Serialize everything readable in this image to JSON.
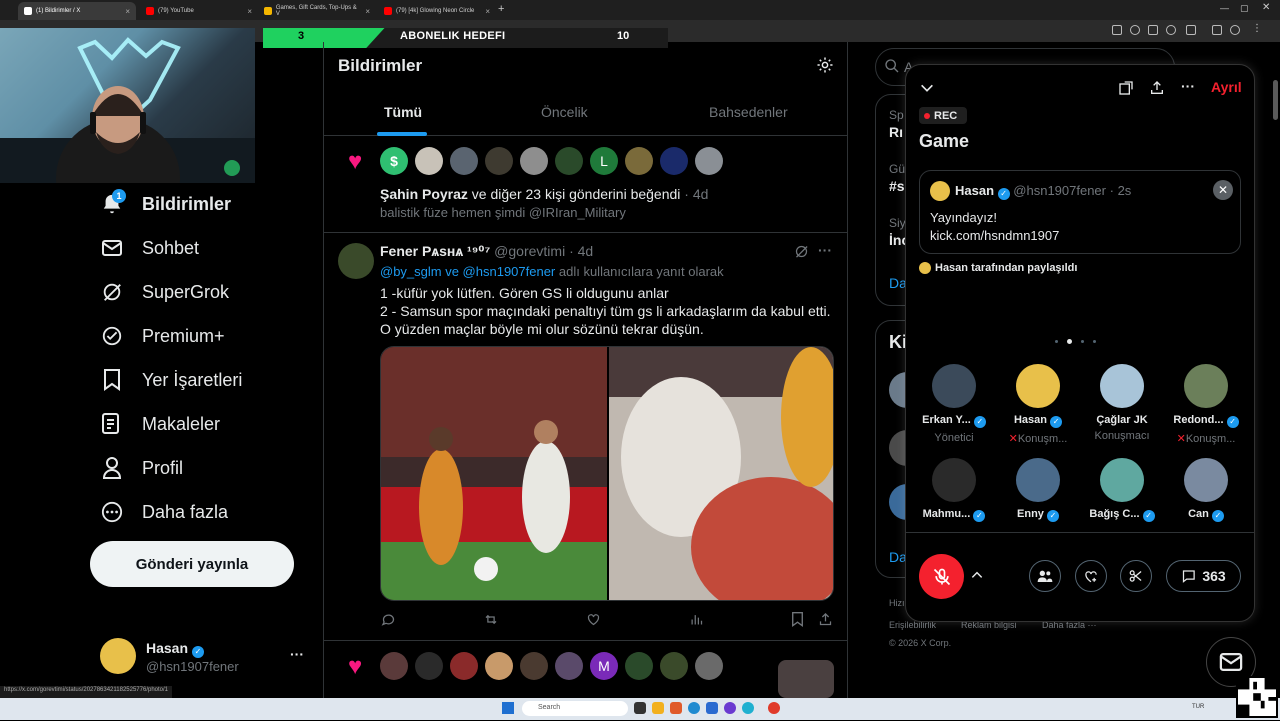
{
  "browser": {
    "tabs": [
      {
        "title": "(1) Bildirimler / X",
        "favicon_color": "#ffffff"
      },
      {
        "title": "(79) YouTube",
        "favicon_color": "#ff0000"
      },
      {
        "title": "Games, Gift Cards, Top-Ups & V",
        "favicon_color": "#f5b700"
      },
      {
        "title": "(79) [4k] Glowing Neon Circle",
        "favicon_color": "#ff0000"
      }
    ],
    "new_tab": "+",
    "status_url": "https://x.com/gorevtimi/status/2027863421182525776/photo/1"
  },
  "overlay": {
    "goal_label": "ABONELIK HEDEFI",
    "current": "3",
    "target": "10",
    "accent": "#1fd15f"
  },
  "nav": {
    "items": [
      {
        "label": "Bildirimler",
        "icon": "bell-icon",
        "badge": "1",
        "active": true
      },
      {
        "label": "Sohbet",
        "icon": "mail-icon"
      },
      {
        "label": "SuperGrok",
        "icon": "grok-icon"
      },
      {
        "label": "Premium+",
        "icon": "verified-icon"
      },
      {
        "label": "Yer İşaretleri",
        "icon": "bookmark-icon"
      },
      {
        "label": "Makaleler",
        "icon": "article-icon"
      },
      {
        "label": "Profil",
        "icon": "person-icon"
      },
      {
        "label": "Daha fazla",
        "icon": "more-circle-icon"
      }
    ],
    "post_button": "Gönderi yayınla",
    "account": {
      "name": "Hasan",
      "handle": "@hsn1907fener",
      "more": "···"
    }
  },
  "timeline": {
    "title": "Bildirimler",
    "tabs": [
      "Tümü",
      "Öncelik",
      "Bahsedenler"
    ],
    "like_notification": {
      "avatar_letters": [
        "$",
        "L"
      ],
      "text_bold": "Şahin Poyraz",
      "text_rest": " ve diğer 23 kişi gönderini beğendi",
      "time": "· 4d",
      "quote": "balistik füze hemen şimdi @IRIran_Military"
    },
    "tweet": {
      "name": "Fener Pѧsнѧ ¹⁹⁰⁷",
      "handle": "@gorevtimi",
      "time": "· 4d",
      "reply_to_users": "@by_sglm ve @hsn1907fener",
      "reply_to_suffix": " adlı kullanıcılara yanıt olarak",
      "lines": [
        "1 -küfür yok lütfen. Gören GS li oldugunu anlar",
        "2 - Samsun spor maçındaki penaltıyi tüm gs li arkadaşlarım da kabul etti.",
        "O yüzden maçlar böyle mi olur sözünü tekrar düşün."
      ]
    },
    "second_notification_avatar_letter": "M"
  },
  "right": {
    "search_placeholder": "A",
    "trend_fragments": [
      "Sp",
      "Rı",
      "Gü",
      "#s",
      "Siy",
      "İnc",
      "Da"
    ],
    "who_to_follow_fragment": "Ki",
    "more_link": "Da",
    "footer_links": [
      "Erişilebilirlik",
      "Reklam bilgisi",
      "Daha fazla ···"
    ],
    "footer_prefix": "Hizı",
    "copyright": "© 2026 X Corp."
  },
  "spaces": {
    "leave": "Ayrıl",
    "rec": "REC",
    "title": "Game",
    "pinned": {
      "name": "Hasan",
      "handle": "@hsn1907fener",
      "time": "· 2s",
      "lines": [
        "Yayındayız!",
        "kick.com/hsndmn1907"
      ]
    },
    "shared_by": "Hasan tarafından paylaşıldı",
    "page_dots": 4,
    "page_active": 1,
    "speakers": [
      {
        "name": "Erkan Y...",
        "role": "Yönetici",
        "color": "#3b4a5a"
      },
      {
        "name": "Hasan",
        "role": "Konuşm...",
        "color": "#e8c04a"
      },
      {
        "name": "Çağlar JK",
        "role": "Konuşmacı",
        "color": "#a8c4d8"
      },
      {
        "name": "Redond...",
        "role": "Konuşm...",
        "color": "#6b7f5a"
      },
      {
        "name": "Mahmu...",
        "role": "",
        "color": "#2a2a2a"
      },
      {
        "name": "Enny",
        "role": "",
        "color": "#4a6a8a"
      },
      {
        "name": "Bağış C...",
        "role": "",
        "color": "#5fa8a0"
      },
      {
        "name": "Can",
        "role": "",
        "color": "#7a8aa0"
      }
    ],
    "listener_count": "363"
  },
  "taskbar": {
    "search_placeholder": "Search",
    "lang": "TUR"
  }
}
